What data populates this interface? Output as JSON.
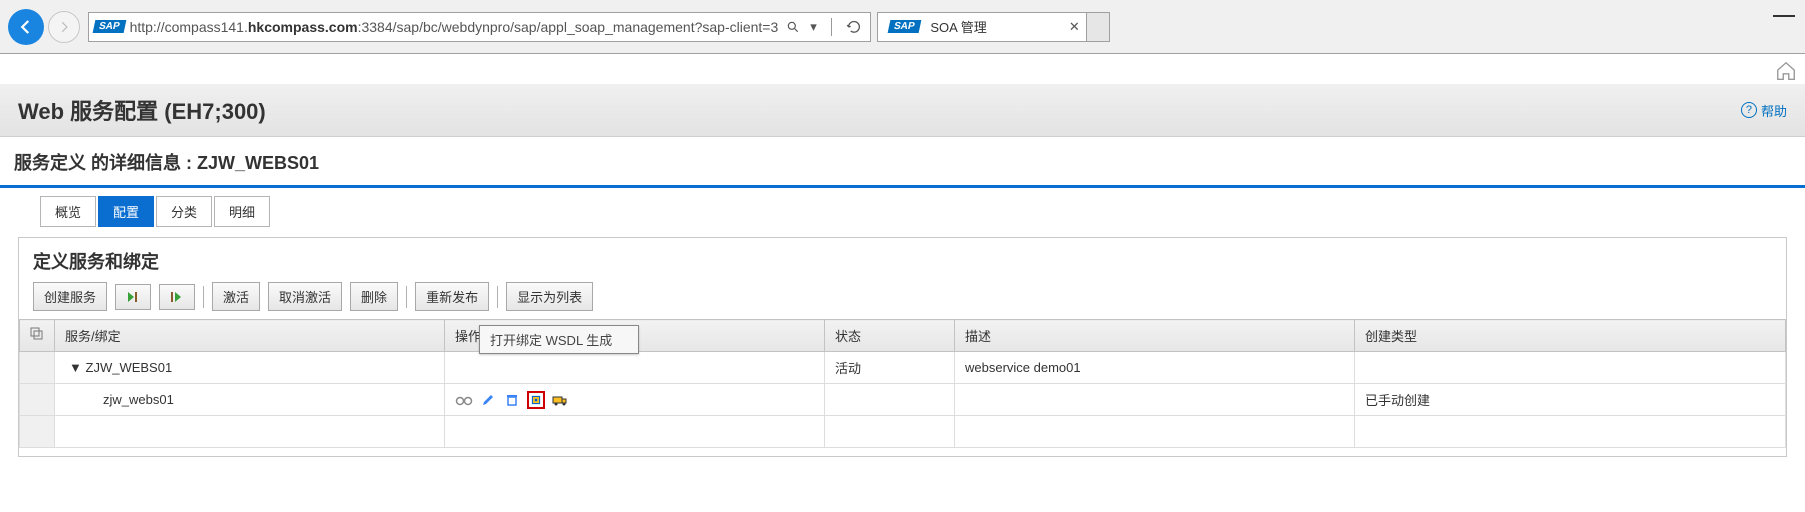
{
  "browser": {
    "url_prefix": "http://compass141.",
    "url_host": "hkcompass.com",
    "url_suffix": ":3384/sap/bc/webdynpro/sap/appl_soap_management?sap-client=3",
    "tab_title": "SOA 管理",
    "sap_badge": "SAP"
  },
  "page_title": "Web 服务配置 (EH7;300)",
  "help_label": "帮助",
  "sub_header": "服务定义 的详细信息 : ZJW_WEBS01",
  "tabs": [
    "概览",
    "配置",
    "分类",
    "明细"
  ],
  "active_tab_index": 1,
  "section_title": "定义服务和绑定",
  "toolbar": {
    "create": "创建服务",
    "activate": "激活",
    "deactivate": "取消激活",
    "delete": "删除",
    "republish": "重新发布",
    "showlist": "显示为列表"
  },
  "columns": {
    "service": "服务/绑定",
    "action": "操作",
    "status": "状态",
    "desc": "描述",
    "ctype": "创建类型"
  },
  "rows": [
    {
      "service": "ZJW_WEBS01",
      "status": "活动",
      "desc": "webservice demo01",
      "ctype": "",
      "level": 0
    },
    {
      "service": "zjw_webs01",
      "status": "",
      "desc": "",
      "ctype": "已手动创建",
      "level": 1
    }
  ],
  "tooltip_text": "打开绑定 WSDL 生成"
}
